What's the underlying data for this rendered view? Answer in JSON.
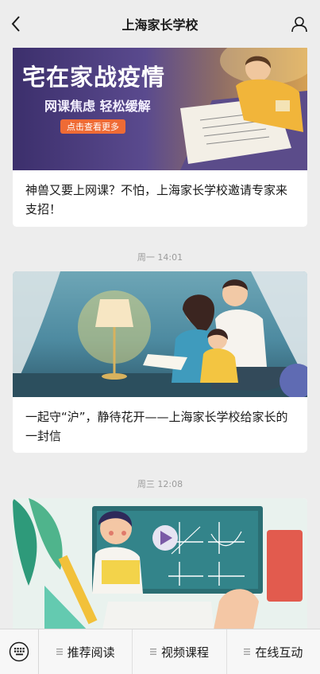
{
  "header": {
    "title": "上海家长学校",
    "back_icon": "chevron-left-icon",
    "profile_icon": "person-icon"
  },
  "articles": [
    {
      "banner": {
        "headline": "宅在家战疫情",
        "subline": "网课焦虑 轻松缓解",
        "pill": "点击查看更多",
        "bg_color": "#5a4a8e"
      },
      "caption": "神兽又要上网课？不怕，上海家长学校邀请专家来支招！"
    },
    {
      "timestamp": "周一 14:01",
      "banner": {
        "bg_color": "#3f6f86"
      },
      "caption": "一起守“沪”，静待花开——上海家长学校给家长的一封信"
    },
    {
      "timestamp": "周三 12:08",
      "banner": {
        "bg_color": "#e8f2ee"
      }
    }
  ],
  "bottom_menu": {
    "keyboard_icon": "keyboard-icon",
    "items": [
      "推荐阅读",
      "视频课程",
      "在线互动"
    ]
  }
}
